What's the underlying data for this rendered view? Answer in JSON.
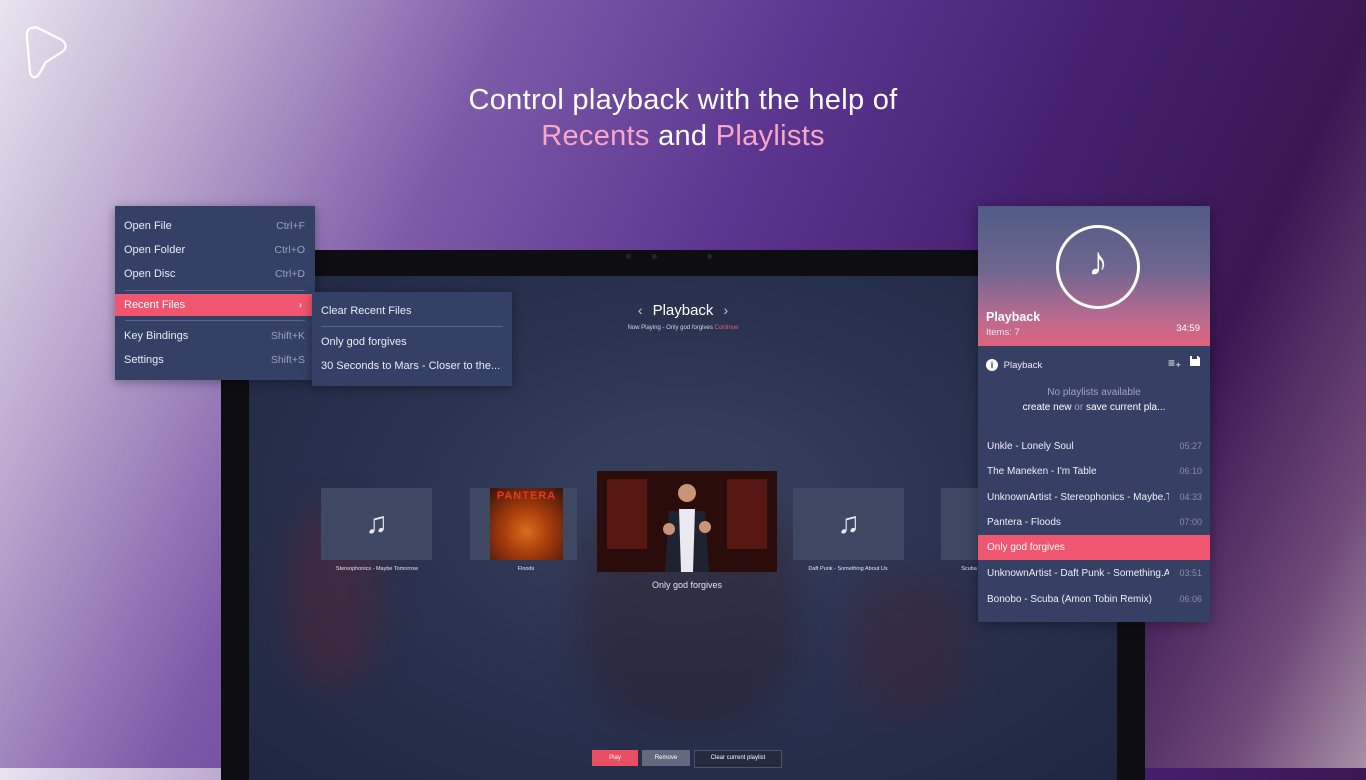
{
  "headline": {
    "line1": "Control playback with the help of",
    "recents": "Recents",
    "and": " and ",
    "playlists": "Playlists"
  },
  "menu": {
    "items": [
      {
        "label": "Open File",
        "shortcut": "Ctrl+F"
      },
      {
        "label": "Open Folder",
        "shortcut": "Ctrl+O"
      },
      {
        "label": "Open Disc",
        "shortcut": "Ctrl+D"
      },
      {
        "label": "Recent Files",
        "shortcut": "›"
      },
      {
        "label": "Key Bindings",
        "shortcut": "Shift+K"
      },
      {
        "label": "Settings",
        "shortcut": "Shift+S"
      }
    ]
  },
  "submenu": {
    "items": [
      {
        "label": "Clear Recent Files"
      },
      {
        "label": "Only god forgives"
      },
      {
        "label": "30 Seconds to Mars - Closer to the..."
      }
    ]
  },
  "player": {
    "title": "Playback",
    "now_playing": "Now Playing - Only god forgives",
    "continue": "Continue",
    "cards": [
      {
        "caption": "Stereophonics - Maybe Tomorrow"
      },
      {
        "caption": "Floods",
        "art_text": "PANTERA"
      },
      {
        "caption": "Only god forgives"
      },
      {
        "caption": "Daft Punk - Something About Us"
      },
      {
        "caption": "Scuba"
      }
    ],
    "buttons": {
      "play": "Play",
      "remove": "Remove",
      "clear": "Clear current playlist"
    }
  },
  "panel": {
    "title": "Playback",
    "items": "Items:  7",
    "duration": "34:59",
    "section": "Playback",
    "empty_line1": "No playlists available",
    "create_new": "create new",
    "or": " or ",
    "save_current": "save current pla...",
    "tracks": [
      {
        "name": "Unkle - Lonely Soul",
        "duration": "05:27"
      },
      {
        "name": "The Maneken - I'm Table",
        "duration": "06:10"
      },
      {
        "name": "UnknownArtist - Stereophonics - Maybe.T",
        "duration": "04:33"
      },
      {
        "name": "Pantera - Floods",
        "duration": "07:00"
      },
      {
        "name": "Only god forgives",
        "duration": ""
      },
      {
        "name": "UnknownArtist - Daft Punk - Something.A",
        "duration": "03:51"
      },
      {
        "name": "Bonobo - Scuba (Amon Tobin Remix)",
        "duration": "06:06"
      }
    ]
  },
  "colors": {
    "accent": "#f0566f",
    "panel_bg": "#363f64",
    "headline_accent": "#f8a7c6"
  },
  "icons": [
    "app-logo-icon",
    "music-note-icon",
    "chevron-left-icon",
    "chevron-right-icon",
    "info-icon",
    "add-playlist-icon",
    "save-icon"
  ]
}
